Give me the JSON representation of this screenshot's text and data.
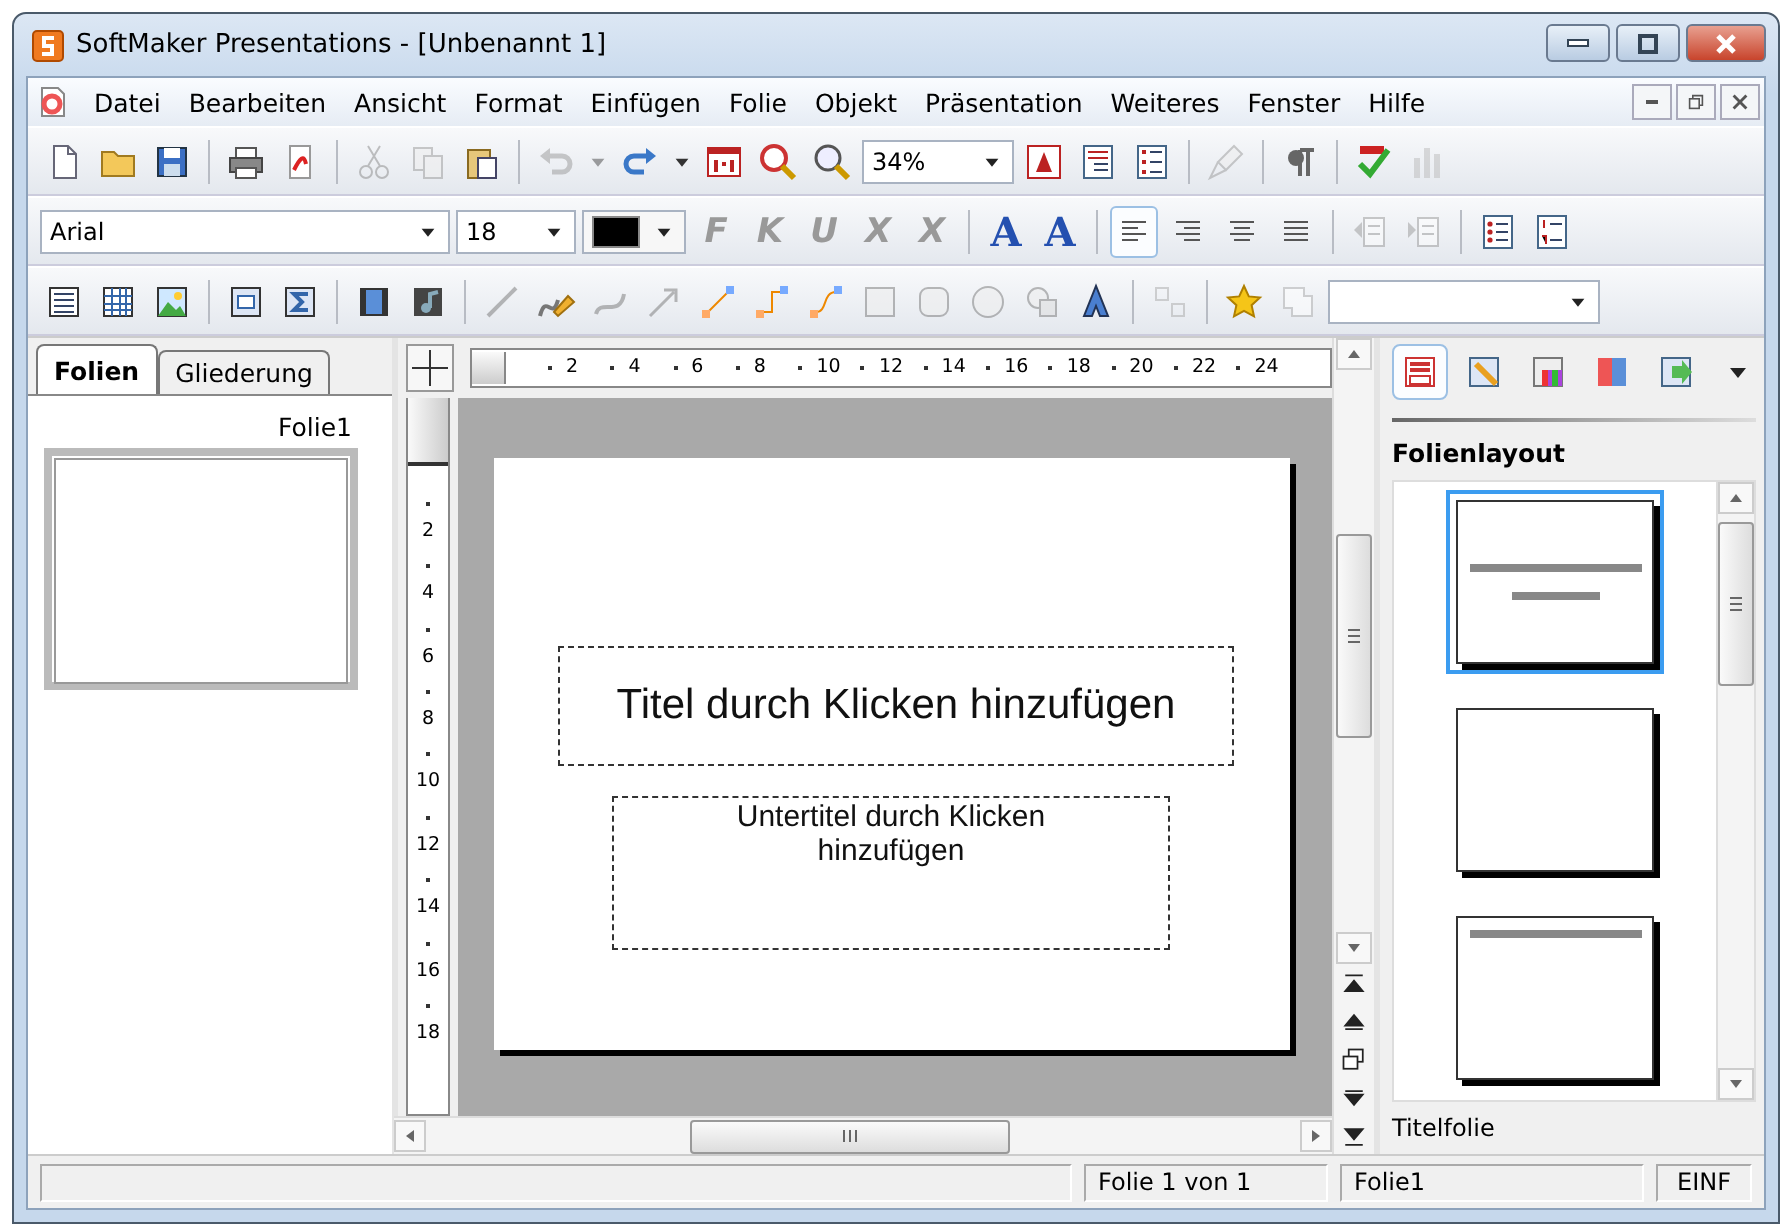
{
  "window": {
    "title": "SoftMaker Presentations - [Unbenannt 1]"
  },
  "menu": [
    {
      "label": "Datei"
    },
    {
      "label": "Bearbeiten"
    },
    {
      "label": "Ansicht"
    },
    {
      "label": "Format"
    },
    {
      "label": "Einfügen"
    },
    {
      "label": "Folie"
    },
    {
      "label": "Objekt"
    },
    {
      "label": "Präsentation"
    },
    {
      "label": "Weiteres"
    },
    {
      "label": "Fenster"
    },
    {
      "label": "Hilfe"
    }
  ],
  "toolbars": [
    {
      "items": [
        {
          "kind": "icon",
          "disabled": false
        },
        {
          "kind": "icon",
          "disabled": false
        },
        {
          "kind": "icon",
          "disabled": false
        },
        {
          "kind": "sep"
        },
        {
          "kind": "icon",
          "disabled": false
        },
        {
          "kind": "icon",
          "disabled": false
        },
        {
          "kind": "sep"
        },
        {
          "kind": "icon",
          "disabled": true
        },
        {
          "kind": "icon",
          "disabled": true
        },
        {
          "kind": "icon",
          "disabled": false
        },
        {
          "kind": "sep"
        },
        {
          "kind": "icon",
          "disabled": true
        },
        {
          "kind": "caret",
          "disabled": true
        },
        {
          "kind": "icon",
          "disabled": false
        },
        {
          "kind": "caret",
          "disabled": false
        },
        {
          "kind": "icon",
          "disabled": false
        },
        {
          "kind": "icon",
          "disabled": false
        },
        {
          "kind": "icon",
          "disabled": false
        },
        {
          "kind": "combo",
          "value": "34%"
        },
        {
          "kind": "icon",
          "disabled": false
        },
        {
          "kind": "icon",
          "disabled": false
        },
        {
          "kind": "icon",
          "disabled": false
        },
        {
          "kind": "sep"
        },
        {
          "kind": "icon",
          "disabled": true
        },
        {
          "kind": "sep"
        },
        {
          "kind": "icon",
          "disabled": false
        },
        {
          "kind": "sep"
        },
        {
          "kind": "icon",
          "disabled": false
        },
        {
          "kind": "icon",
          "disabled": true
        }
      ]
    },
    {
      "items": [
        {
          "kind": "combo",
          "value": "Arial"
        },
        {
          "kind": "combo",
          "value": "18"
        },
        {
          "kind": "color",
          "color": "#000000"
        },
        {
          "kind": "glyph",
          "text": "F",
          "disabled": true
        },
        {
          "kind": "glyph",
          "text": "K",
          "disabled": true
        },
        {
          "kind": "glyph",
          "text": "U",
          "disabled": true
        },
        {
          "kind": "glyph",
          "text": "X",
          "disabled": true
        },
        {
          "kind": "glyph",
          "text": "X",
          "disabled": true
        },
        {
          "kind": "sep"
        },
        {
          "kind": "big-glyph",
          "text": "A",
          "disabled": false
        },
        {
          "kind": "big-glyph",
          "text": "A",
          "disabled": false
        },
        {
          "kind": "sep"
        },
        {
          "kind": "icon",
          "disabled": false,
          "selected": true
        },
        {
          "kind": "icon",
          "disabled": false,
          "selected": false
        },
        {
          "kind": "icon",
          "disabled": false,
          "selected": false
        },
        {
          "kind": "icon",
          "disabled": false,
          "selected": false
        },
        {
          "kind": "sep"
        },
        {
          "kind": "icon",
          "disabled": true
        },
        {
          "kind": "icon",
          "disabled": true
        },
        {
          "kind": "sep"
        },
        {
          "kind": "icon",
          "disabled": false
        },
        {
          "kind": "icon",
          "disabled": false
        }
      ]
    },
    {
      "items": [
        {
          "kind": "icon",
          "disabled": false
        },
        {
          "kind": "icon",
          "disabled": false
        },
        {
          "kind": "icon",
          "disabled": false
        },
        {
          "kind": "sep"
        },
        {
          "kind": "icon",
          "disabled": false
        },
        {
          "kind": "icon",
          "disabled": false
        },
        {
          "kind": "sep"
        },
        {
          "kind": "icon",
          "disabled": false
        },
        {
          "kind": "icon",
          "disabled": false
        },
        {
          "kind": "sep"
        },
        {
          "kind": "icon",
          "disabled": true
        },
        {
          "kind": "icon",
          "disabled": false
        },
        {
          "kind": "icon",
          "disabled": true
        },
        {
          "kind": "icon",
          "disabled": true
        },
        {
          "kind": "icon",
          "disabled": false
        },
        {
          "kind": "icon",
          "disabled": false
        },
        {
          "kind": "icon",
          "disabled": false
        },
        {
          "kind": "icon",
          "disabled": true
        },
        {
          "kind": "icon",
          "disabled": true
        },
        {
          "kind": "icon",
          "disabled": true
        },
        {
          "kind": "icon",
          "disabled": true
        },
        {
          "kind": "icon",
          "disabled": false
        },
        {
          "kind": "sep"
        },
        {
          "kind": "icon",
          "disabled": true
        },
        {
          "kind": "sep"
        },
        {
          "kind": "icon",
          "disabled": false
        },
        {
          "kind": "icon",
          "disabled": true
        },
        {
          "kind": "combo"
        }
      ]
    }
  ],
  "side_panel": {
    "tabs": [
      {
        "label": "Folien",
        "selected": true
      },
      {
        "label": "Gliederung",
        "selected": false
      }
    ],
    "slides": [
      {
        "label": "Folie1",
        "selected": true
      }
    ]
  },
  "ruler": {
    "horizontal": [
      "2",
      "4",
      "6",
      "8",
      "10",
      "12",
      "14",
      "16",
      "18",
      "20",
      "22",
      "24"
    ],
    "vertical": [
      "2",
      "4",
      "6",
      "8",
      "10",
      "12",
      "14",
      "16",
      "18"
    ]
  },
  "slide": {
    "title_placeholder": "Titel durch Klicken hinzufügen",
    "subtitle_placeholder": "Untertitel durch Klicken hinzufügen"
  },
  "task_pane": {
    "tabs": [
      {
        "selected": true
      },
      {
        "selected": false
      },
      {
        "selected": false
      },
      {
        "selected": false
      },
      {
        "selected": false
      }
    ],
    "heading": "Folienlayout",
    "layouts": [
      {
        "kind": "title",
        "selected": true
      },
      {
        "kind": "blank",
        "selected": false
      },
      {
        "kind": "title-only",
        "selected": false
      }
    ],
    "caption": "Titelfolie"
  },
  "status_bar": {
    "fields": [
      "Folie 1 von 1",
      "Folie1",
      "EINF"
    ]
  }
}
